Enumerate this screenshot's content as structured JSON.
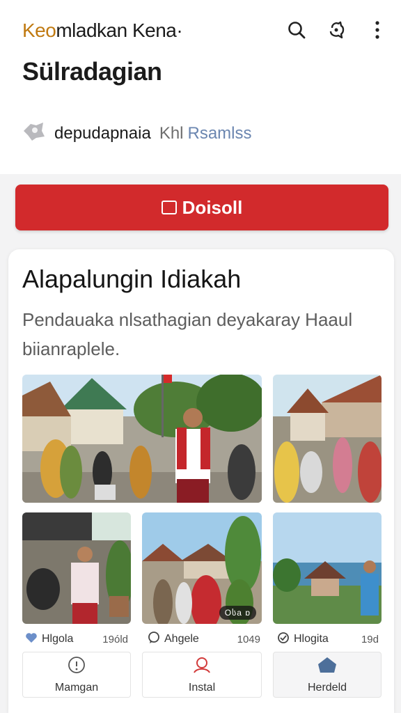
{
  "header": {
    "brand_accent": "Keo",
    "brand_rest": "mladkan Kena·",
    "title": "Sülradagian",
    "author_name": "depudapnaia",
    "author_muted": "Khl",
    "author_blue": "Rsamlss"
  },
  "icons": {
    "search": "search-icon",
    "share": "share-icon",
    "more": "more-icon",
    "author": "avatar-icon"
  },
  "cta": {
    "label": "Doisoll",
    "color": "#d22a2c"
  },
  "article": {
    "title": "Alapalungin Idiakah",
    "description": "Pendauaka nlsathagian deyakaray Haaul biianraplele."
  },
  "photos": {
    "p4_badge": "Oსa ɒ"
  },
  "items": [
    {
      "label": "Hlgola",
      "count": "19óld"
    },
    {
      "label": "Ahgele",
      "count": "1049"
    },
    {
      "label": "Hlogita",
      "count": "19d"
    }
  ],
  "tabs": [
    {
      "label": "Mamgan",
      "icon": "info-icon"
    },
    {
      "label": "Instal",
      "icon": "person-icon"
    },
    {
      "label": "Herdeld",
      "icon": "home-icon"
    }
  ]
}
